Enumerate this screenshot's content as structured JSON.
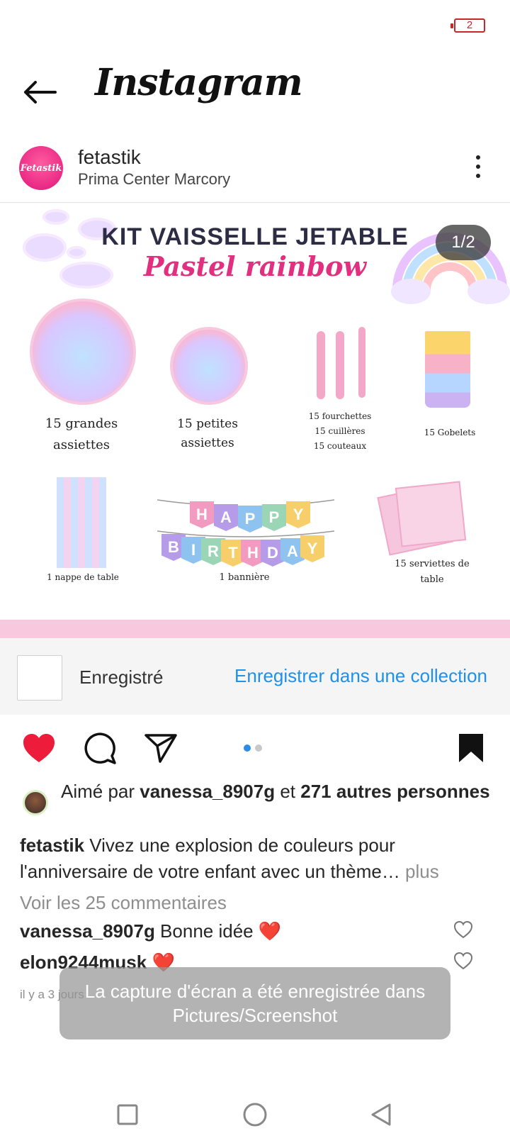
{
  "status_bar": {
    "battery_level": "2"
  },
  "app": {
    "title": "Instagram"
  },
  "post": {
    "username": "fetastik",
    "avatar_text": "Fetastik",
    "location": "Prima Center Marcory",
    "image": {
      "counter": "1/2",
      "title_line1": "KIT VAISSELLE JETABLE",
      "title_line2": "Pastel rainbow",
      "items": {
        "large_plates": [
          "15 grandes",
          "assiettes"
        ],
        "small_plates": [
          "15 petites",
          "assiettes"
        ],
        "cutlery": [
          "15 fourchettes",
          "15 cuillères",
          "15 couteaux"
        ],
        "cups": "15 Gobelets",
        "tablecloth": "1 nappe de table",
        "banner": "1 bannière",
        "napkins": [
          "15 serviettes de",
          "table"
        ]
      },
      "banner_letters": [
        "H",
        "A",
        "P",
        "P",
        "Y",
        "B",
        "I",
        "R",
        "T",
        "H",
        "D",
        "A",
        "Y"
      ]
    },
    "saved_bar": {
      "label": "Enregistré",
      "action": "Enregistrer dans une collection"
    },
    "carousel": {
      "current": 1,
      "total": 2
    },
    "likes": {
      "prefix": "Aimé par ",
      "user": "vanessa_8907g",
      "middle": " et ",
      "others": "271 autres personnes"
    },
    "caption": {
      "username": "fetastik",
      "text": " Vivez une explosion de couleurs pour l'anniversaire de votre enfant avec un thème…",
      "more": " plus"
    },
    "view_comments": "Voir les 25 commentaires",
    "comments": [
      {
        "username": "vanessa_8907g",
        "text": " Bonne idée ❤️"
      },
      {
        "username": "elon9244musk",
        "text": " ❤️"
      }
    ],
    "timestamp": "il y a 3 jours"
  },
  "toast": {
    "line1": "La capture d'écran a été enregistrée dans",
    "line2": "Pictures/Screenshot"
  },
  "colors": {
    "accent_blue": "#2090e8",
    "heart_red": "#ed1c3b",
    "brand_pink": "#e0157a"
  }
}
